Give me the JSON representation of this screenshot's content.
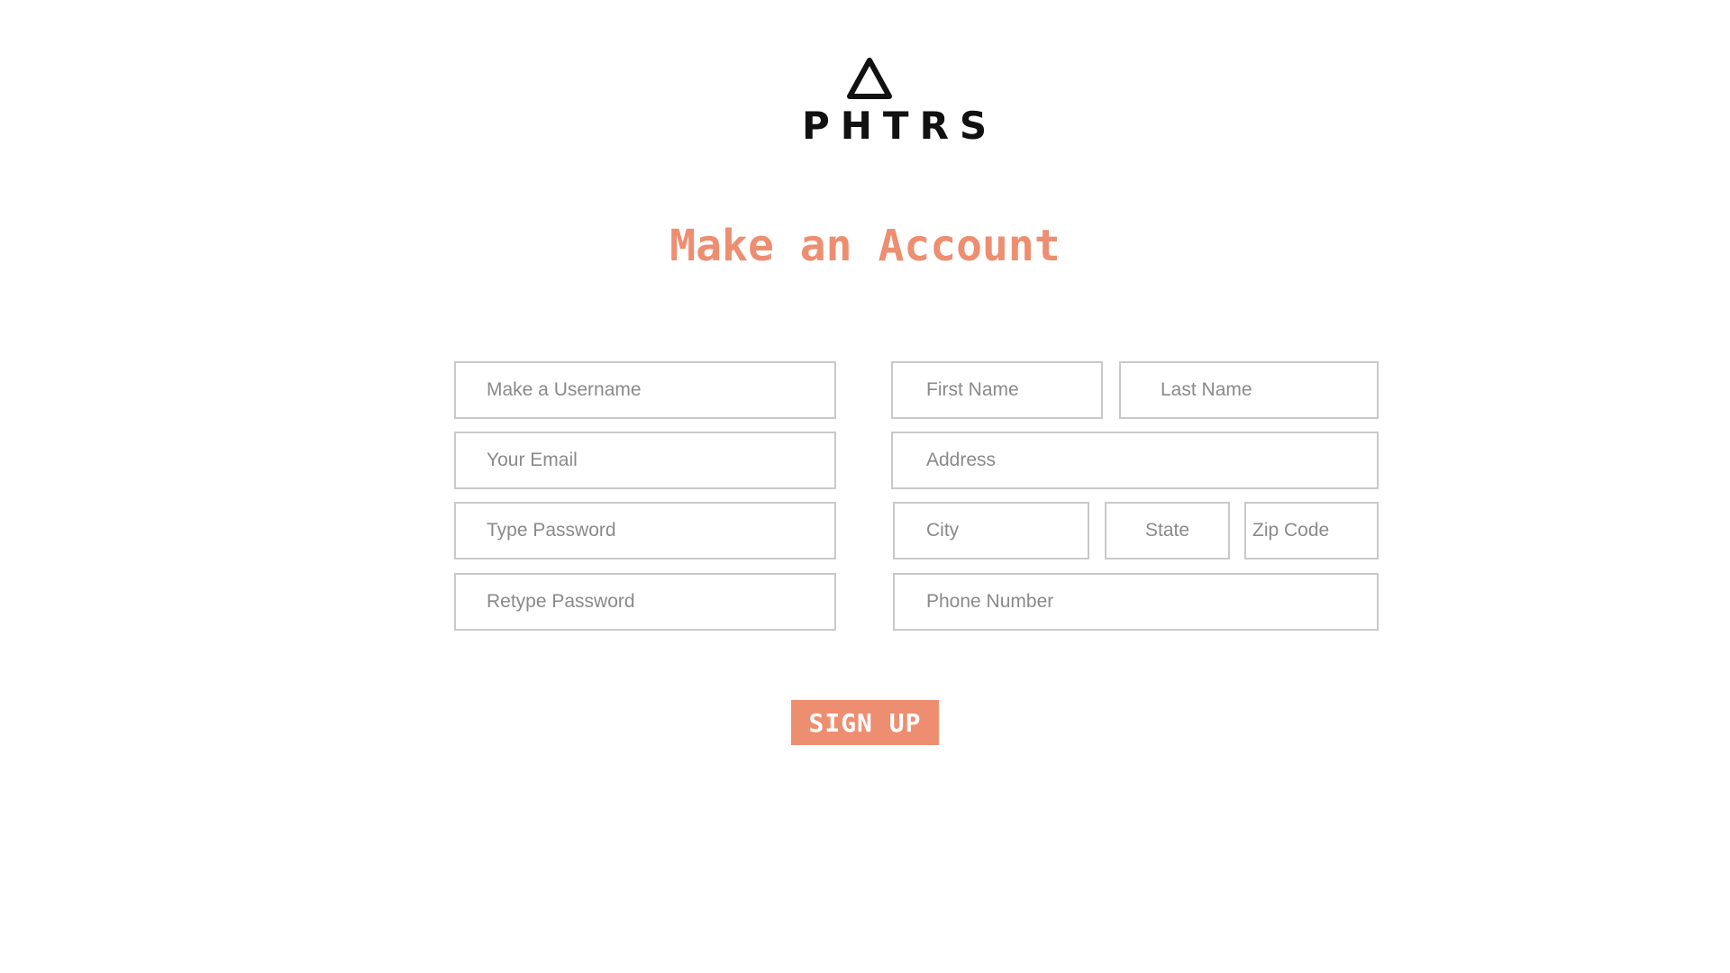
{
  "brand": {
    "logo_text": "PHTRS",
    "logo_icon": "triangle-icon"
  },
  "page": {
    "title": "Make an Account"
  },
  "form": {
    "username": {
      "placeholder": "Make a Username",
      "value": ""
    },
    "email": {
      "placeholder": "Your Email",
      "value": ""
    },
    "password": {
      "placeholder": "Type Password",
      "value": ""
    },
    "retype_password": {
      "placeholder": "Retype Password",
      "value": ""
    },
    "first_name": {
      "placeholder": "First Name",
      "value": ""
    },
    "last_name": {
      "placeholder": "Last Name",
      "value": ""
    },
    "address": {
      "placeholder": "Address",
      "value": ""
    },
    "city": {
      "placeholder": "City",
      "value": ""
    },
    "state": {
      "placeholder": "State",
      "value": ""
    },
    "zip_code": {
      "placeholder": "Zip Code",
      "value": ""
    },
    "phone_number": {
      "placeholder": "Phone Number",
      "value": ""
    },
    "submit_label": "SIGN UP"
  },
  "colors": {
    "accent": "#EE8E70",
    "logo": "#111111",
    "field_border": "#C9C9C9",
    "placeholder": "#8A8A8A",
    "background": "#FFFFFF"
  }
}
